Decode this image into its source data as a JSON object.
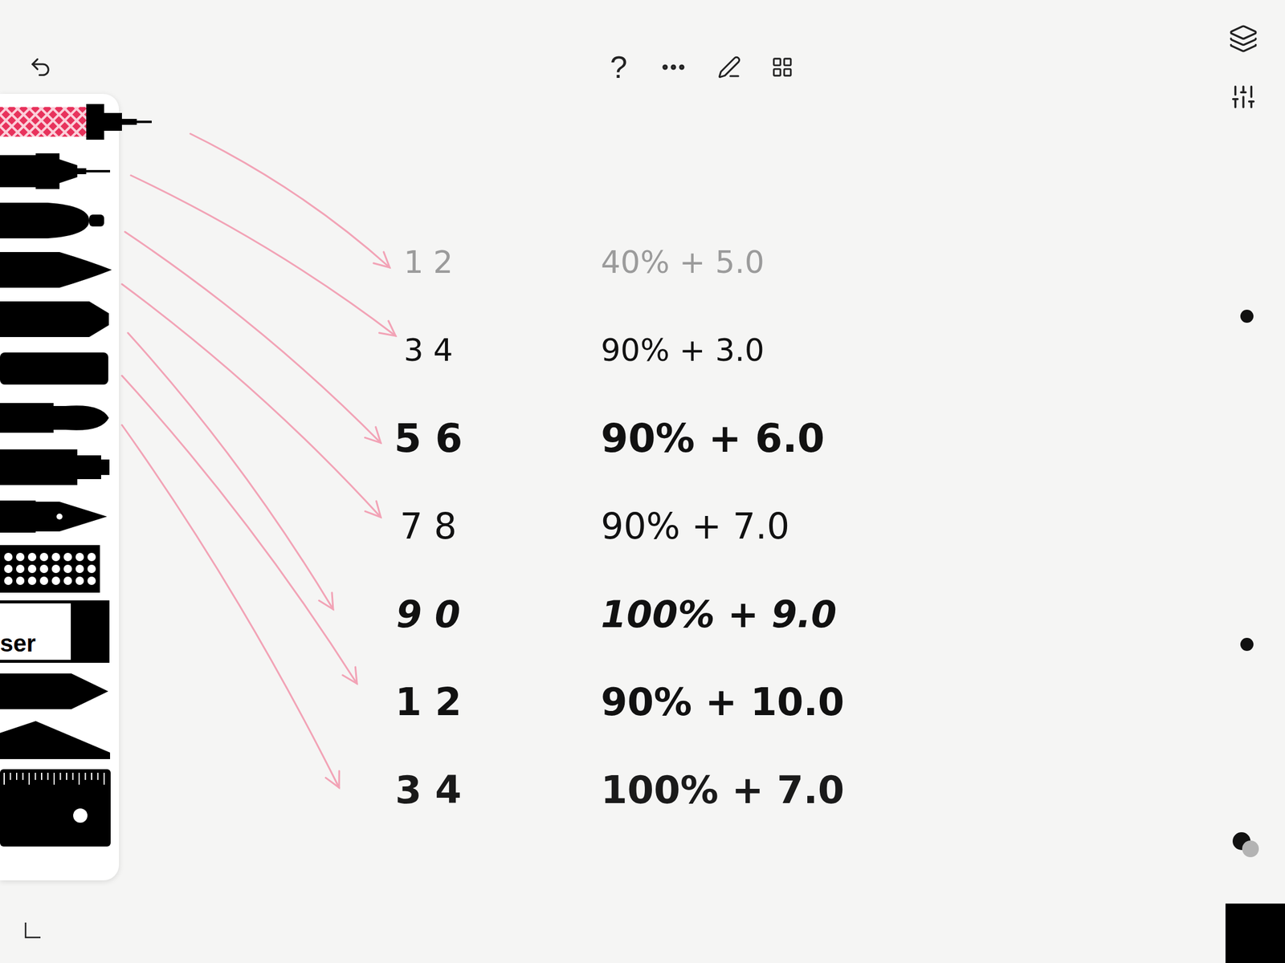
{
  "toolbar": {
    "help": "?"
  },
  "palette": {
    "tools": [
      {
        "kind": "mechanical-pencil",
        "selected": true
      },
      {
        "kind": "technical-pen",
        "selected": false
      },
      {
        "kind": "marker",
        "selected": false
      },
      {
        "kind": "brush-pen",
        "selected": false
      },
      {
        "kind": "chisel-marker",
        "selected": false
      },
      {
        "kind": "thick-marker",
        "selected": false
      },
      {
        "kind": "round-brush",
        "selected": false
      },
      {
        "kind": "felt-pen",
        "selected": false
      },
      {
        "kind": "fountain-pen",
        "selected": false
      },
      {
        "kind": "stamp",
        "selected": false
      },
      {
        "kind": "eraser",
        "selected": false,
        "label": "ser"
      },
      {
        "kind": "pencil",
        "selected": false
      },
      {
        "kind": "blade",
        "selected": false
      },
      {
        "kind": "ruler",
        "selected": false
      }
    ]
  },
  "canvas": {
    "rows": [
      {
        "left": "1 2",
        "right": "40% + 5.0",
        "kind": "thin",
        "color": "#9b9b9b"
      },
      {
        "left": "3 4",
        "right": "90% + 3.0",
        "kind": "thin",
        "color": "#111111"
      },
      {
        "left": "5 6",
        "right": "90% + 6.0",
        "kind": "bold",
        "color": "#111111"
      },
      {
        "left": "7 8",
        "right": "90% + 7.0",
        "kind": "medium",
        "color": "#111111"
      },
      {
        "left": "9 0",
        "right": "100% + 9.0",
        "kind": "textured",
        "color": "#111111"
      },
      {
        "left": "1 2",
        "right": "90% + 10.0",
        "kind": "brush",
        "color": "#111111"
      },
      {
        "left": "3 4",
        "right": "100% + 7.0",
        "kind": "brush",
        "color": "#1a1a1a"
      }
    ]
  },
  "swatch": {
    "color": "#111111",
    "secondary_color": "#b3b3b3"
  }
}
